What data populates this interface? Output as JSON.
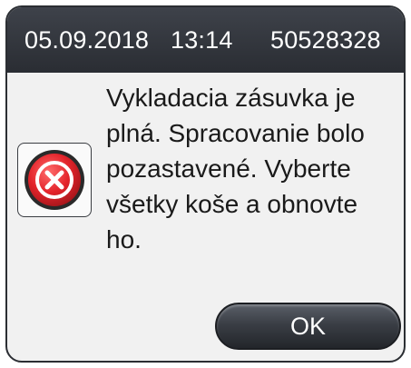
{
  "header": {
    "date": "05.09.2018",
    "time": "13:14",
    "serial": "50528328"
  },
  "message": {
    "icon": "error-x-icon",
    "text": "Vykladacia zásuvka je\nplná. Spracovanie bolo\npozastavené. Vyberte\nvšetky koše a obnovte\nho."
  },
  "buttons": {
    "ok_label": "OK"
  },
  "colors": {
    "titlebar": "#2f3238",
    "error_red": "#e3242b",
    "dialog_background": "#f1f1f1"
  }
}
